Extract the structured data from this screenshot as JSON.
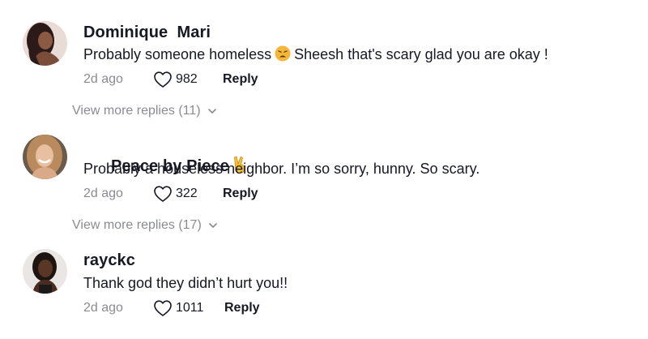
{
  "comments": [
    {
      "username": "Dominique  Mari",
      "text_before": "Probably someone homeless",
      "emoji_icon": "tired-face-emoji-icon",
      "text_after": "Sheesh that's scary glad you are okay !",
      "time": "2d ago",
      "likes": "982",
      "reply_label": "Reply",
      "view_more": "View more replies (11)"
    },
    {
      "username": "Peace by Piece",
      "badge_icon": "victory-hand-emoji-icon",
      "text": "Probably a houseless neighbor. I’m so sorry, hunny. So scary.",
      "time": "2d ago",
      "likes": "322",
      "reply_label": "Reply",
      "view_more": "View more replies (17)"
    },
    {
      "username": "rayckc",
      "text": "Thank god they didn’t hurt you!!",
      "time": "2d ago",
      "likes": "1011",
      "reply_label": "Reply"
    }
  ],
  "icons": {
    "heart": "heart-outline-icon",
    "chevron": "chevron-down-icon"
  },
  "colors": {
    "primary_text": "#161823",
    "secondary_text": "#8a8b91"
  }
}
